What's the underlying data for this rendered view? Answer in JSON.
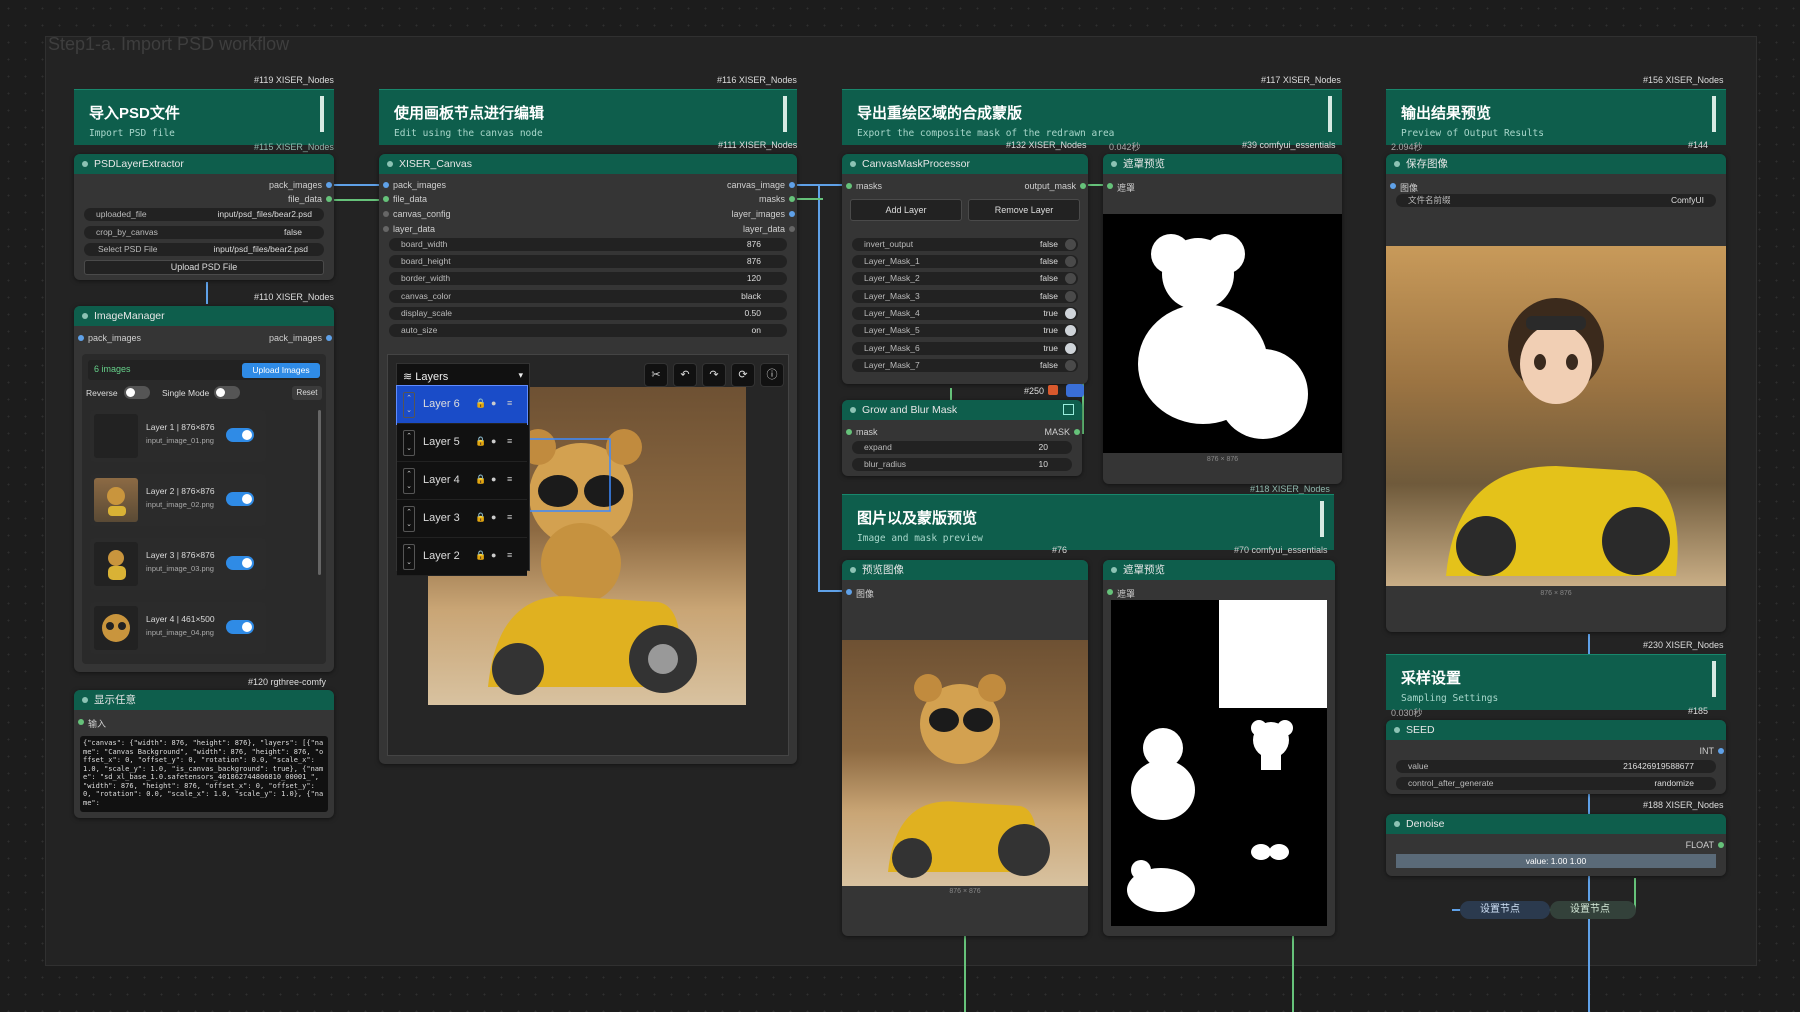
{
  "group_title": "Step1-a. Import PSD workflow",
  "tags": {
    "t119": "#119 XISER_Nodes",
    "t115": "#115 XISER_Nodes",
    "t116": "#116 XISER_Nodes",
    "t111": "#111 XISER_Nodes",
    "t117": "#117 XISER_Nodes",
    "t132": "#132 XISER_Nodes",
    "t39": "#39 comfyui_essentials",
    "t042": "0.042秒",
    "t156": "#156 XISER_Nodes",
    "t2094": "2.094秒",
    "t144": "#144",
    "t110": "#110 XISER_Nodes",
    "t120": "#120 rgthree-comfy",
    "t250": "#250",
    "t118": "#118 XISER_Nodes",
    "t76": "#76",
    "t70": "#70 comfyui_essentials",
    "t230": "#230 XISER_Nodes",
    "t030": "0.030秒",
    "t185": "#185",
    "t188": "#188 XISER_Nodes"
  },
  "notes": {
    "import": {
      "title": "导入PSD文件",
      "sub": "Import PSD file"
    },
    "edit": {
      "title": "使用画板节点进行编辑",
      "sub": "Edit using the canvas node"
    },
    "export": {
      "title": "导出重绘区域的合成蒙版",
      "sub": "Export the composite mask of the redrawn area"
    },
    "output": {
      "title": "输出结果预览",
      "sub": "Preview of Output Results"
    },
    "preview": {
      "title": "图片以及蒙版预览",
      "sub": "Image and mask preview"
    },
    "sampling": {
      "title": "采样设置",
      "sub": "Sampling Settings"
    }
  },
  "psd": {
    "title": "PSDLayerExtractor",
    "out1": "pack_images",
    "out2": "file_data",
    "w1l": "uploaded_file",
    "w1v": "input/psd_files/bear2.psd",
    "w2l": "crop_by_canvas",
    "w2v": "false",
    "w3l": "Select PSD File",
    "w3v": "input/psd_files/bear2.psd",
    "btn": "Upload PSD File"
  },
  "im": {
    "title": "ImageManager",
    "in": "pack_images",
    "out": "pack_images",
    "count": "6 images",
    "upload": "Upload Images",
    "reverse": "Reverse",
    "single": "Single Mode",
    "reset": "Reset",
    "layers": [
      {
        "name": "Layer 1 | 876×876",
        "file": "input_image_01.png"
      },
      {
        "name": "Layer 2 | 876×876",
        "file": "input_image_02.png"
      },
      {
        "name": "Layer 3 | 876×876",
        "file": "input_image_03.png"
      },
      {
        "name": "Layer 4 | 461×500",
        "file": "input_image_04.png"
      }
    ]
  },
  "show": {
    "title": "显示任意",
    "in": "输入",
    "text": "{\"canvas\": {\"width\": 876, \"height\": 876}, \"layers\": [{\"name\": \"Canvas Background\", \"width\": 876, \"height\": 876, \"offset_x\": 0, \"offset_y\": 0, \"rotation\": 0.0, \"scale_x\": 1.0, \"scale_y\": 1.0, \"is_canvas_background\": true}, {\"name\": \"sd_xl_base_1.0.safetensors_401862744806810_00001_\", \"width\": 876, \"height\": 876, \"offset_x\": 0, \"offset_y\": 0, \"rotation\": 0.0, \"scale_x\": 1.0, \"scale_y\": 1.0}, {\"name\":"
  },
  "cv": {
    "title": "XISER_Canvas",
    "in": [
      "pack_images",
      "file_data",
      "canvas_config",
      "layer_data"
    ],
    "out": [
      "canvas_image",
      "masks",
      "layer_images",
      "layer_data"
    ],
    "widgets": [
      {
        "l": "board_width",
        "v": "876"
      },
      {
        "l": "board_height",
        "v": "876"
      },
      {
        "l": "border_width",
        "v": "120"
      },
      {
        "l": "canvas_color",
        "v": "black"
      },
      {
        "l": "display_scale",
        "v": "0.50"
      },
      {
        "l": "auto_size",
        "v": "on"
      }
    ],
    "layers_title": "Layers",
    "rows": [
      "Layer 6",
      "Layer 5",
      "Layer 4",
      "Layer 3",
      "Layer 2"
    ]
  },
  "cmp": {
    "title": "CanvasMaskProcessor",
    "in": "masks",
    "out": "output_mask",
    "add": "Add Layer",
    "remove": "Remove Layer",
    "widgets": [
      {
        "l": "invert_output",
        "v": "false"
      },
      {
        "l": "Layer_Mask_1",
        "v": "false"
      },
      {
        "l": "Layer_Mask_2",
        "v": "false"
      },
      {
        "l": "Layer_Mask_3",
        "v": "false"
      },
      {
        "l": "Layer_Mask_4",
        "v": "true"
      },
      {
        "l": "Layer_Mask_5",
        "v": "true"
      },
      {
        "l": "Layer_Mask_6",
        "v": "true"
      },
      {
        "l": "Layer_Mask_7",
        "v": "false"
      }
    ]
  },
  "gb": {
    "title": "Grow and Blur Mask",
    "in": "mask",
    "out": "MASK",
    "w1l": "expand",
    "w1v": "20",
    "w2l": "blur_radius",
    "w2v": "10"
  },
  "mp1": {
    "title": "遮罩预览",
    "in": "遮罩",
    "res": "876 × 876"
  },
  "save": {
    "title": "保存图像",
    "in": "图像",
    "wl": "文件名前缀",
    "wv": "ComfyUI",
    "res": "876 × 876"
  },
  "pi": {
    "title": "预览图像",
    "in": "图像",
    "res": "876 × 876"
  },
  "mp2": {
    "title": "遮罩预览",
    "in": "遮罩"
  },
  "seed": {
    "title": "SEED",
    "type": "INT",
    "w1l": "value",
    "w1v": "216426919588677",
    "w2l": "control_after_generate",
    "w2v": "randomize"
  },
  "den": {
    "title": "Denoise",
    "type": "FLOAT",
    "val": "value: 1.00  1.00"
  },
  "set1": "设置节点",
  "set2": "设置节点",
  "colors": {
    "teal": "#0e5e4c",
    "node": "#353535",
    "accent_blue": "#2f8be6",
    "wire_green": "#66c27a",
    "wire_blue": "#5fa1e8"
  }
}
